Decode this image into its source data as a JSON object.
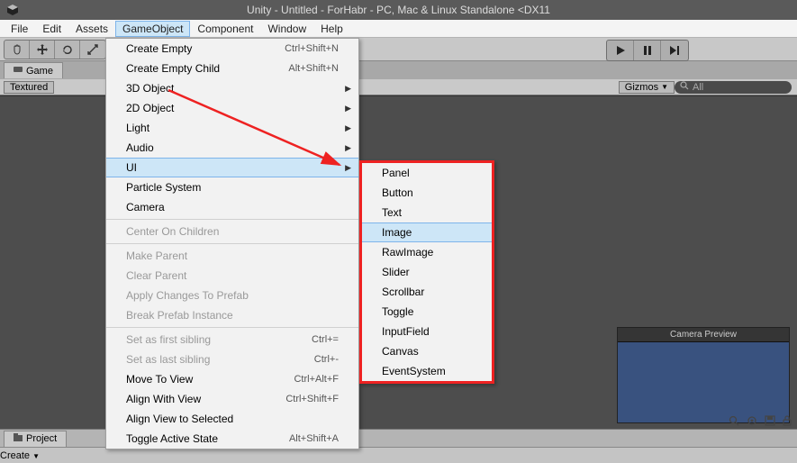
{
  "title": "Unity - Untitled - ForHabr - PC, Mac & Linux Standalone <DX11",
  "menubar": [
    "File",
    "Edit",
    "Assets",
    "GameObject",
    "Component",
    "Window",
    "Help"
  ],
  "menubar_active_index": 3,
  "tab_game": "Game",
  "subbar": {
    "textured": "Textured",
    "gizmos": "Gizmos",
    "search_placeholder": "All"
  },
  "go_menu": {
    "create_empty": {
      "label": "Create Empty",
      "shortcut": "Ctrl+Shift+N"
    },
    "create_empty_child": {
      "label": "Create Empty Child",
      "shortcut": "Alt+Shift+N"
    },
    "three_d": "3D Object",
    "two_d": "2D Object",
    "light": "Light",
    "audio": "Audio",
    "ui": "UI",
    "particle": "Particle System",
    "camera": "Camera",
    "center_children": "Center On Children",
    "make_parent": "Make Parent",
    "clear_parent": "Clear Parent",
    "apply_prefab": "Apply Changes To Prefab",
    "break_prefab": "Break Prefab Instance",
    "first_sibling": {
      "label": "Set as first sibling",
      "shortcut": "Ctrl+="
    },
    "last_sibling": {
      "label": "Set as last sibling",
      "shortcut": "Ctrl+-"
    },
    "move_to_view": {
      "label": "Move To View",
      "shortcut": "Ctrl+Alt+F"
    },
    "align_with_view": {
      "label": "Align With View",
      "shortcut": "Ctrl+Shift+F"
    },
    "align_view_selected": "Align View to Selected",
    "toggle_active": {
      "label": "Toggle Active State",
      "shortcut": "Alt+Shift+A"
    }
  },
  "ui_menu": [
    "Panel",
    "Button",
    "Text",
    "Image",
    "RawImage",
    "Slider",
    "Scrollbar",
    "Toggle",
    "InputField",
    "Canvas",
    "EventSystem"
  ],
  "ui_menu_highlight_index": 3,
  "camera_preview": "Camera Preview",
  "project_tab": "Project",
  "create_btn": "Create"
}
